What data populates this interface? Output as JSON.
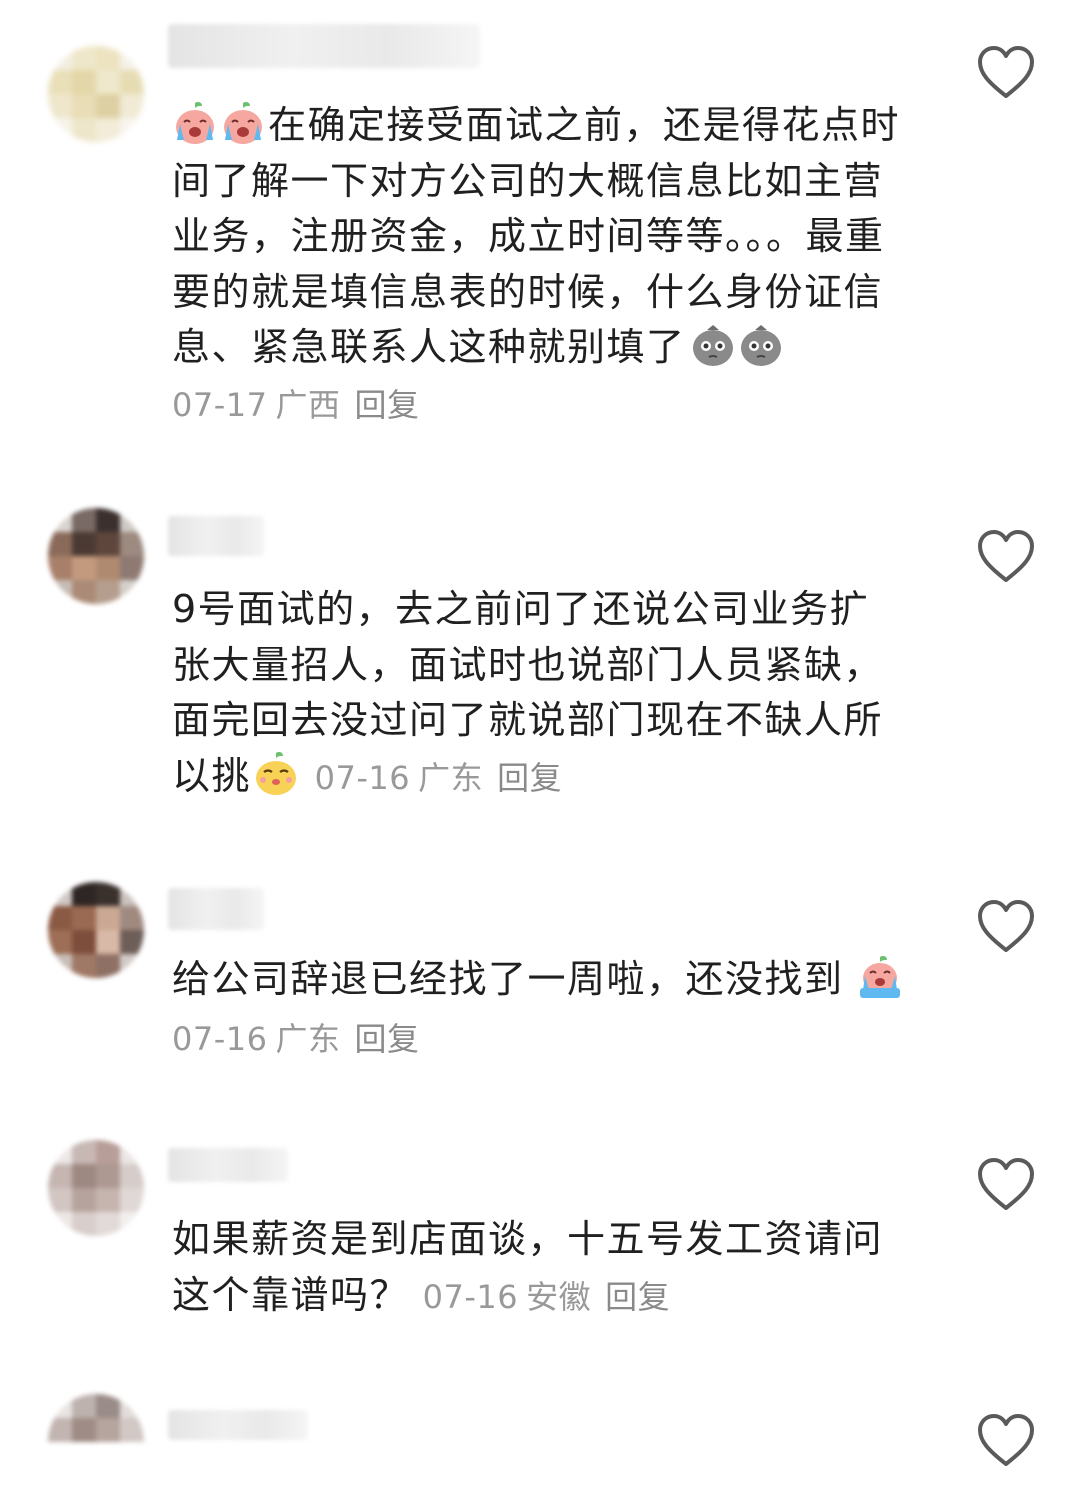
{
  "comments": [
    {
      "text": "在确定接受面试之前，还是得花点时间了解一下对方公司的大概信息比如主营业务，注册资金，成立时间等等。。。最重要的就是填信息表的时候，什么身份证信息、紧急联系人这种就别填了",
      "date": "07-17",
      "location": "广西",
      "reply": "回复"
    },
    {
      "text": "9号面试的，去之前问了还说公司业务扩张大量招人，面试时也说部门人员紧缺，面完回去没过问了就说部门现在不缺人所以挑",
      "date": "07-16",
      "location": "广东",
      "reply": "回复"
    },
    {
      "text": "给公司辞退已经找了一周啦，还没找到",
      "date": "07-16",
      "location": "广东",
      "reply": "回复"
    },
    {
      "text": "如果薪资是到店面谈，十五号发工资请问这个靠谱吗？",
      "date": "07-16",
      "location": "安徽",
      "reply": "回复"
    }
  ],
  "icons": {
    "like": "heart-outline-icon",
    "emoji_cry": "crying-face-emoji",
    "emoji_speechless": "speechless-face-emoji",
    "emoji_sly": "sly-face-emoji",
    "emoji_bigcry": "big-crying-face-emoji"
  },
  "colors": {
    "meta": "#999999",
    "text": "#202020",
    "heart": "#5a5a5a"
  }
}
